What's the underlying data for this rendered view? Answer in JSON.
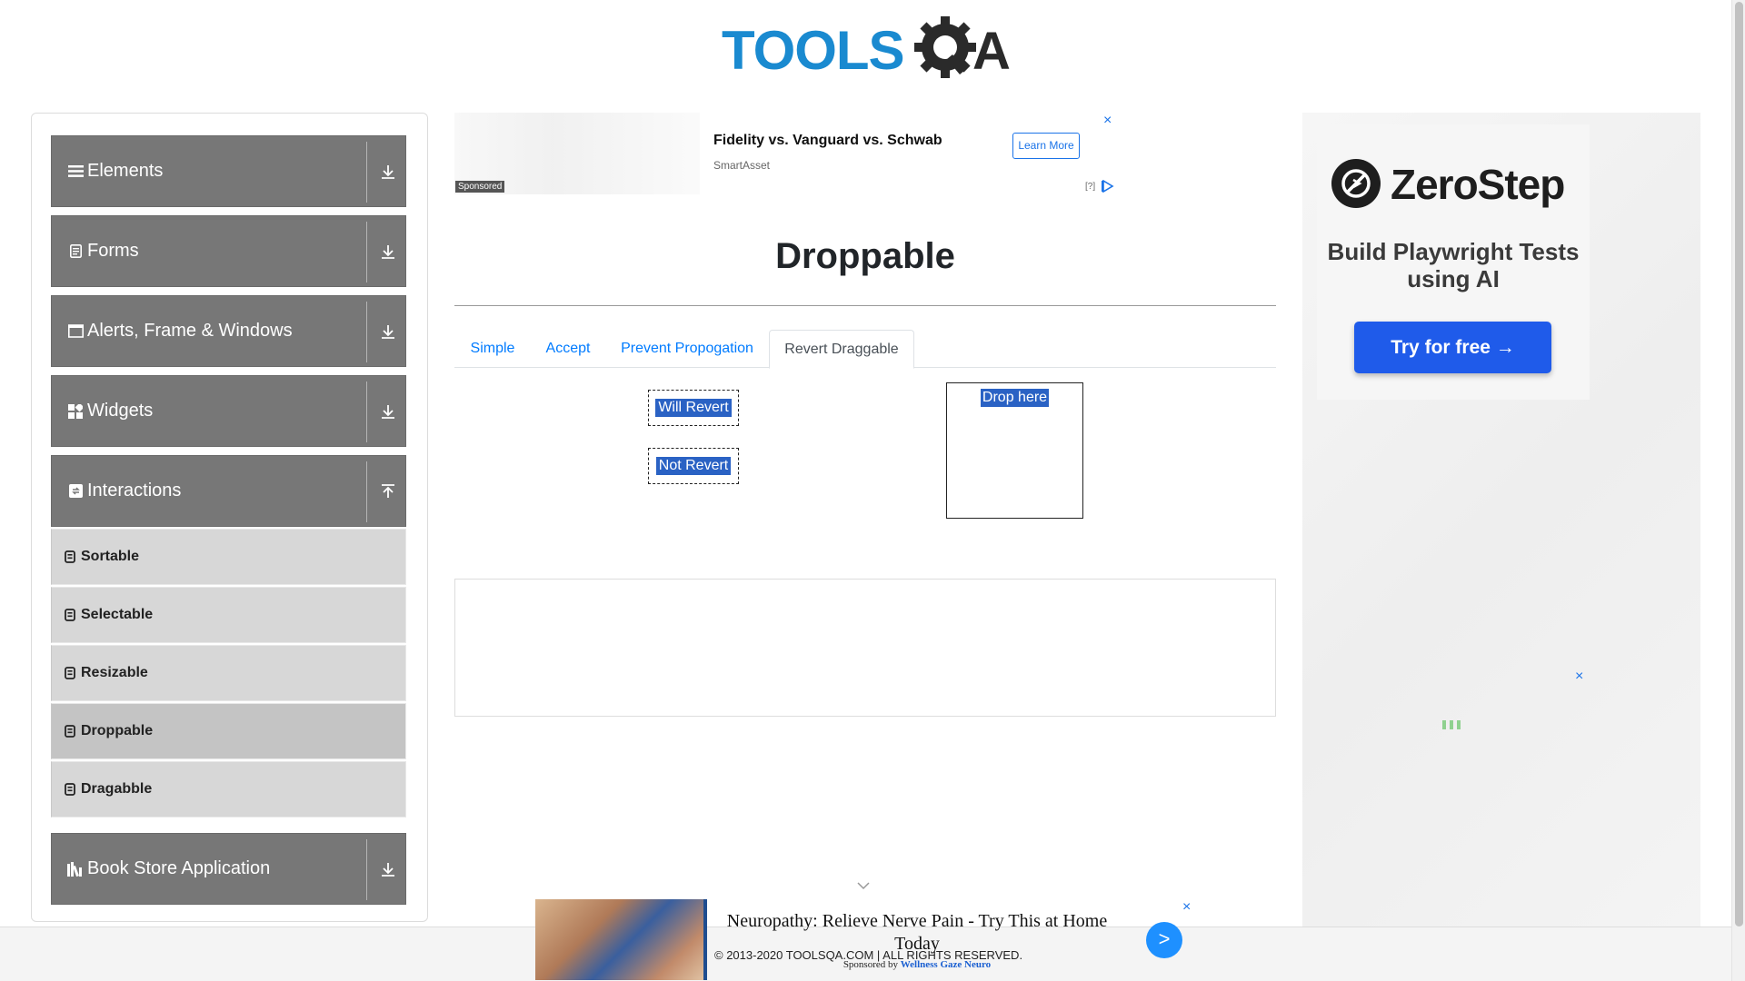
{
  "logo": {
    "text": "TOOLSQA"
  },
  "sidebar": {
    "groups": [
      {
        "label": "Elements",
        "icon": "menu-icon",
        "state": "collapsed"
      },
      {
        "label": "Forms",
        "icon": "form-icon",
        "state": "collapsed"
      },
      {
        "label": "Alerts, Frame & Windows",
        "icon": "window-icon",
        "state": "collapsed"
      },
      {
        "label": "Widgets",
        "icon": "widgets-icon",
        "state": "collapsed"
      },
      {
        "label": "Interactions",
        "icon": "interactions-icon",
        "state": "expanded"
      },
      {
        "label": "Book Store Application",
        "icon": "books-icon",
        "state": "collapsed"
      }
    ],
    "interactions_items": [
      {
        "label": "Sortable",
        "active": false
      },
      {
        "label": "Selectable",
        "active": false
      },
      {
        "label": "Resizable",
        "active": false
      },
      {
        "label": "Droppable",
        "active": true
      },
      {
        "label": "Dragabble",
        "active": false
      }
    ]
  },
  "top_ad": {
    "title": "Fidelity vs. Vanguard vs. Schwab",
    "source": "SmartAsset",
    "cta": "Learn More",
    "sponsored": "Sponsored",
    "info": "[?]",
    "close": "×"
  },
  "main": {
    "title": "Droppable",
    "tabs": [
      {
        "label": "Simple",
        "active": false
      },
      {
        "label": "Accept",
        "active": false
      },
      {
        "label": "Prevent Propogation",
        "active": false
      },
      {
        "label": "Revert Draggable",
        "active": true
      }
    ],
    "draggables": [
      "Will Revert",
      "Not Revert"
    ],
    "drop_target": "Drop here"
  },
  "right_ad": {
    "brand": "ZeroStep",
    "tagline": "Build Playwright Tests using AI",
    "cta": "Try for free →",
    "close": "×"
  },
  "footer": {
    "copyright": "© 2013-2020 TOOLSQA.COM | ALL RIGHTS RESERVED."
  },
  "bottom_ad": {
    "headline": "Neuropathy: Relieve Nerve Pain - Try This at Home Today",
    "sponsored_prefix": "Sponsored by",
    "sponsor": "Wellness Gaze Neuro",
    "go": ">",
    "close": "×"
  },
  "colors": {
    "sidebar_group_bg": "#777777",
    "sidebar_sub_bg": "#d7d7d7",
    "link_blue": "#007bff",
    "highlight_blue": "#2a62c4",
    "zerostep_blue": "#1f5bea"
  }
}
